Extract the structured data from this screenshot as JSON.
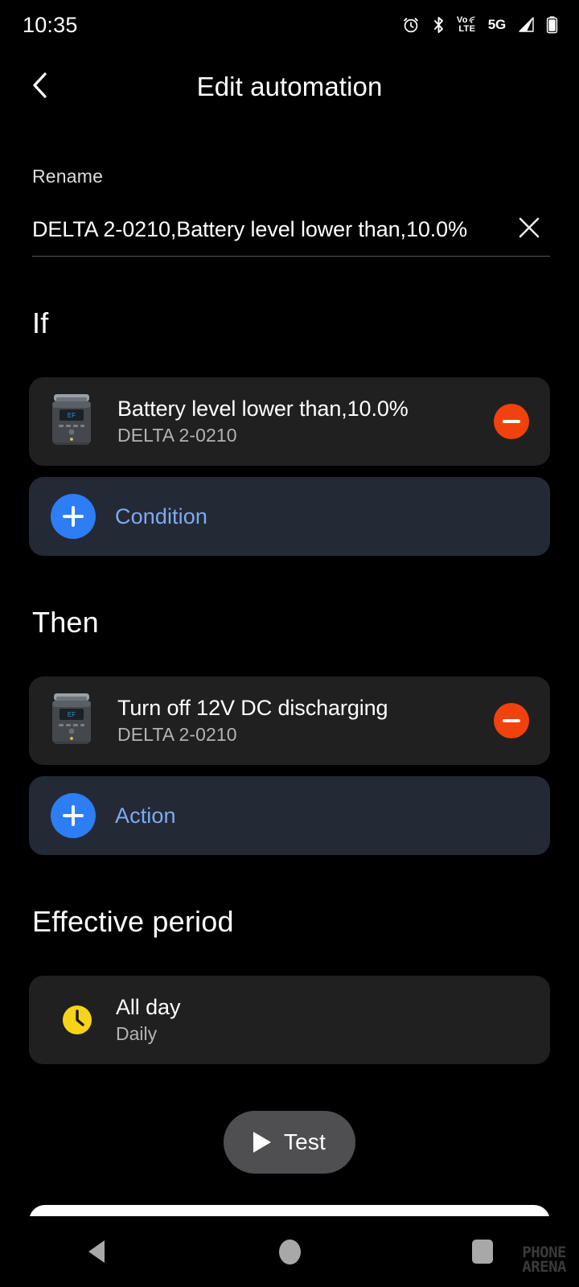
{
  "status_bar": {
    "time": "10:35",
    "icons": [
      "alarm-icon",
      "bluetooth-icon",
      "volte-icon",
      "5g-icon",
      "signal-icon",
      "battery-icon"
    ],
    "volte_top": "Vo",
    "volte_bottom": "LTE",
    "network": "5G"
  },
  "appbar": {
    "back_icon": "chevron-left-icon",
    "title": "Edit automation"
  },
  "rename": {
    "label": "Rename",
    "value": "DELTA 2-0210,Battery level lower than,10.0%",
    "clear_icon": "close-icon"
  },
  "sections": {
    "if": {
      "title": "If",
      "card": {
        "title": "Battery level lower than,10.0%",
        "subtitle": "DELTA 2-0210",
        "thumb_icon": "power-station-icon",
        "remove_icon": "minus-circle-icon"
      },
      "add": {
        "label": "Condition",
        "icon": "plus-circle-icon"
      }
    },
    "then": {
      "title": "Then",
      "card": {
        "title": "Turn off 12V DC discharging",
        "subtitle": "DELTA 2-0210",
        "thumb_icon": "power-station-icon",
        "remove_icon": "minus-circle-icon"
      },
      "add": {
        "label": "Action",
        "icon": "plus-circle-icon"
      }
    },
    "effective_period": {
      "title": "Effective period",
      "card": {
        "title": "All day",
        "subtitle": "Daily",
        "icon": "clock-icon"
      }
    }
  },
  "test_button": {
    "label": "Test",
    "icon": "play-icon"
  },
  "nav_bar": {
    "back": "back-triangle-icon",
    "home": "home-circle-icon",
    "recents": "recents-square-icon"
  },
  "watermark": {
    "line1": "PHONE",
    "line2": "ARENA"
  },
  "colors": {
    "background": "#000000",
    "card": "#202020",
    "add_card": "#232a36",
    "accent_blue": "#2d7df4",
    "link_blue": "#7fa9f0",
    "remove_red": "#F1410D",
    "clock_yellow": "#F7D417",
    "test_gray": "#4f4f51"
  }
}
